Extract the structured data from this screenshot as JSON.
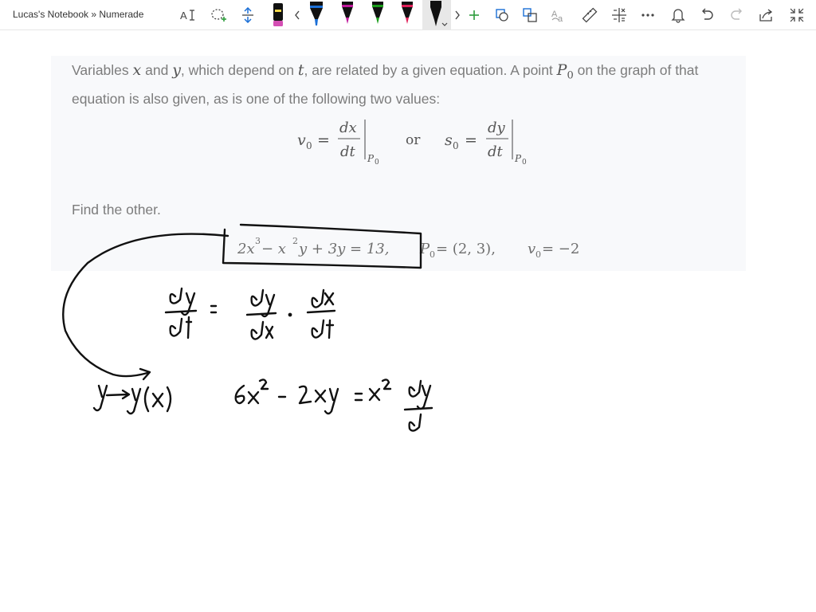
{
  "window": {
    "title": "Lucas's Notebook » Numerade"
  },
  "toolbar": {
    "icons": [
      "text-format-icon",
      "lasso-select-icon",
      "insert-space-icon",
      "pen-black-icon",
      "scroll-left-icon",
      "pen-blue-icon",
      "pen-magenta-icon",
      "pen-green-icon",
      "pen-pink-icon",
      "pen-black-active-icon",
      "scroll-right-icon",
      "add-pen-icon",
      "shapes-icon",
      "ink-to-shape-icon",
      "ink-to-text-icon",
      "ruler-icon",
      "math-icon",
      "more-icon",
      "bell-icon",
      "undo-icon",
      "redo-icon",
      "share-icon",
      "fullscreen-icon"
    ],
    "pen_colors": {
      "black": "#111111",
      "blue": "#1b6fd6",
      "magenta": "#c01a9c",
      "green": "#1b9d1b",
      "pink": "#e0205a"
    },
    "accent": "#2d9c3c"
  },
  "problem": {
    "sentence_1_a": "Variables ",
    "var_x": "x",
    "sentence_1_b": " and ",
    "var_y": "y",
    "sentence_1_c": ", which depend on ",
    "var_t": "t",
    "sentence_1_d": ", are related by a given equation. A point ",
    "point_P0": "P",
    "point_P0_sub": "0",
    "sentence_1_e": " on the graph of that equation is also given, as is one of the following two values:",
    "formula": {
      "v0": "v",
      "v0_sub": "0",
      "eq": "=",
      "dx": "dx",
      "dt": "dt",
      "or": "or",
      "s0": "s",
      "s0_sub": "0",
      "dy": "dy",
      "P": "P",
      "P_sub": "0"
    },
    "instruction": "Find the other.",
    "equation": {
      "lhs_a": "2x",
      "lhs_a_exp": "3",
      "lhs_b": " − x",
      "lhs_b_exp": "2",
      "lhs_c": "y + 3y = 13,",
      "point": "P",
      "point_sub": "0",
      "point_val": " = (2, 3),",
      "v": "v",
      "v_sub": "0",
      "v_val": " = −2"
    }
  },
  "handwriting": {
    "ink_color": "#111111",
    "chain_rule": [
      "dy",
      "dt",
      "=",
      "dy",
      "dx",
      "·",
      "dx",
      "dt"
    ],
    "substitution": "y → y(x)",
    "derivative": [
      "6x",
      "2",
      "- 2xy",
      "+ x",
      "2",
      "dy",
      "d"
    ]
  }
}
